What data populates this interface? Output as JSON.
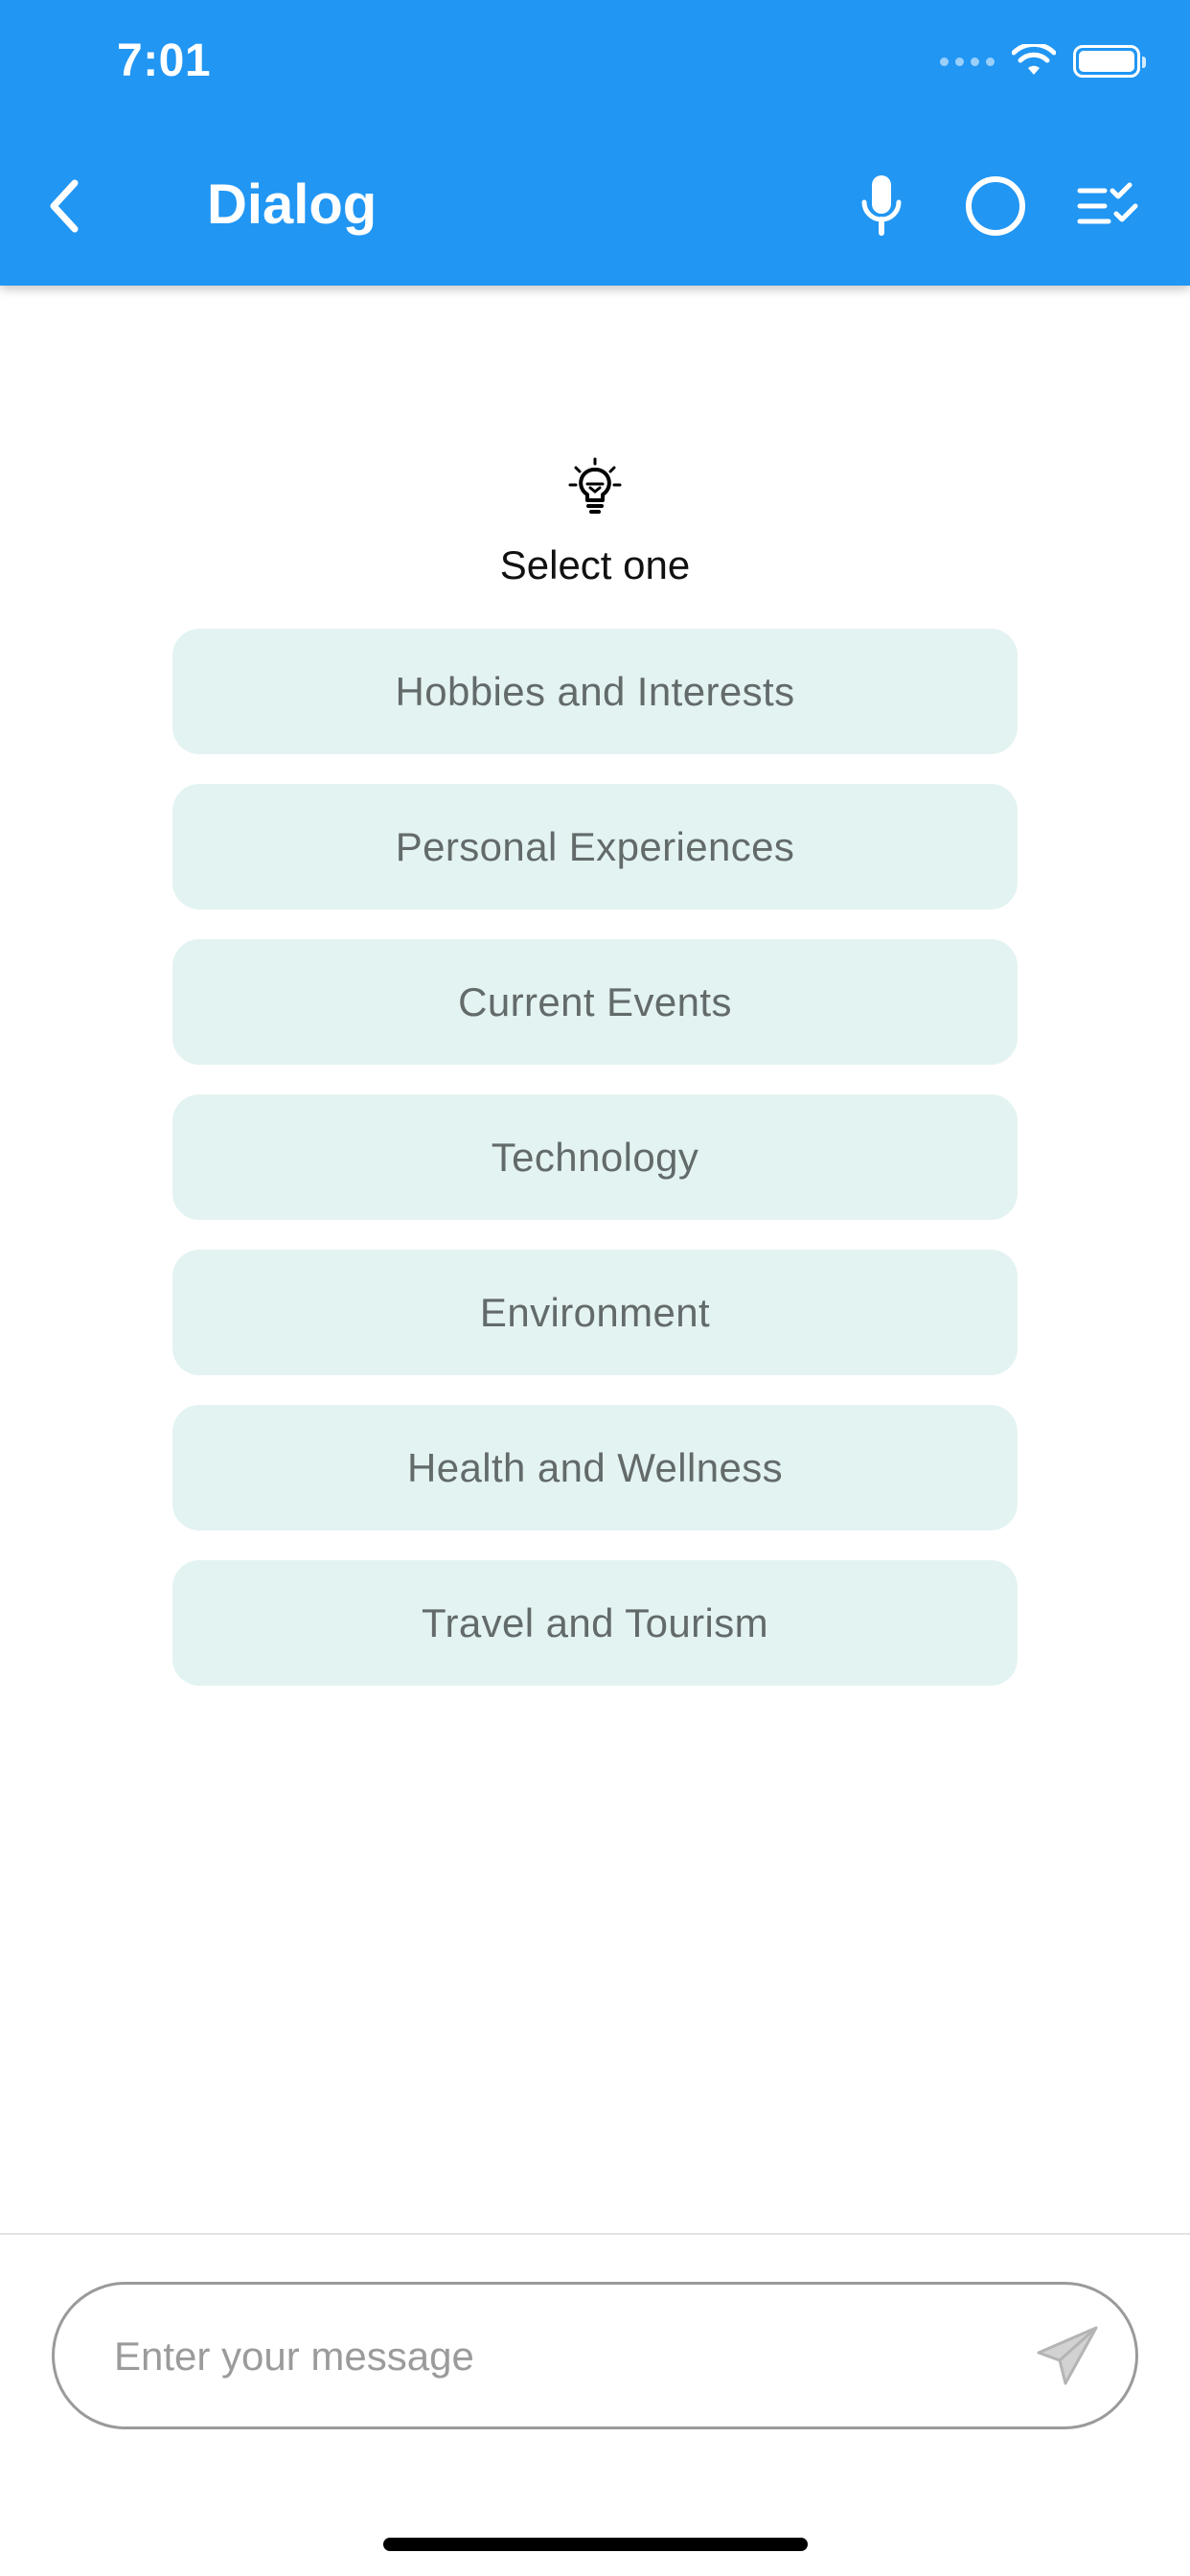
{
  "status_bar": {
    "time": "7:01"
  },
  "app_bar": {
    "title": "Dialog",
    "icons": [
      "chevron-left-icon",
      "microphone-icon",
      "circle-icon",
      "checklist-icon"
    ]
  },
  "prompt": {
    "icon": "lightbulb-icon",
    "text": "Select one"
  },
  "options": [
    {
      "label": "Hobbies and Interests"
    },
    {
      "label": "Personal Experiences"
    },
    {
      "label": "Current Events"
    },
    {
      "label": "Technology"
    },
    {
      "label": "Environment"
    },
    {
      "label": "Health and Wellness"
    },
    {
      "label": "Travel and Tourism"
    }
  ],
  "composer": {
    "placeholder": "Enter your message",
    "value": "",
    "send_icon": "send-icon"
  },
  "colors": {
    "header_bg": "#2196f3",
    "option_bg": "#e3f3f2",
    "option_text": "#636a6a"
  }
}
